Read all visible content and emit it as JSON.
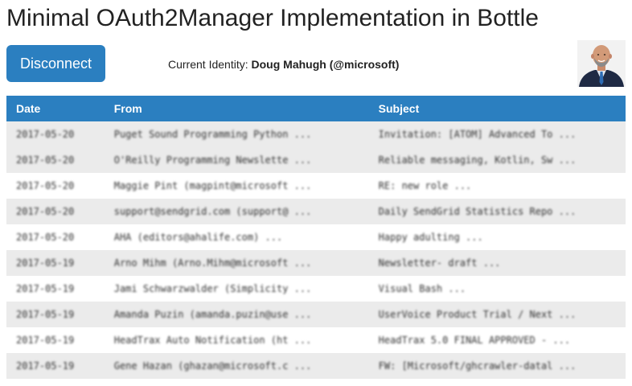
{
  "title": "Minimal OAuth2Manager Implementation in Bottle",
  "disconnect_label": "Disconnect",
  "identity": {
    "label": "Current Identity:",
    "name": "Doug Mahugh (@microsoft)"
  },
  "avatar": {
    "icon": "user-photo"
  },
  "colors": {
    "accent": "#2b7fc0",
    "row_band": "#ebebeb"
  },
  "table": {
    "headers": [
      "Date",
      "From",
      "Subject"
    ],
    "rows": [
      {
        "date": "2017-05-20",
        "from": "Puget Sound Programming Python ...",
        "subject": "Invitation: [ATOM] Advanced To ..."
      },
      {
        "date": "2017-05-20",
        "from": "O'Reilly Programming Newslette ...",
        "subject": "Reliable messaging, Kotlin, Sw ..."
      },
      {
        "date": "2017-05-20",
        "from": "Maggie Pint (magpint@microsoft ...",
        "subject": "RE: new role ..."
      },
      {
        "date": "2017-05-20",
        "from": "support@sendgrid.com (support@ ...",
        "subject": "Daily SendGrid Statistics Repo ..."
      },
      {
        "date": "2017-05-20",
        "from": "AHA (editors@ahalife.com) ...",
        "subject": "Happy adulting ..."
      },
      {
        "date": "2017-05-19",
        "from": "Arno Mihm (Arno.Mihm@microsoft ...",
        "subject": "Newsletter- draft ..."
      },
      {
        "date": "2017-05-19",
        "from": "Jami Schwarzwalder (Simplicity ...",
        "subject": "Visual Bash ..."
      },
      {
        "date": "2017-05-19",
        "from": "Amanda Puzin (amanda.puzin@use ...",
        "subject": "UserVoice Product Trial / Next ..."
      },
      {
        "date": "2017-05-19",
        "from": "HeadTrax Auto Notification (ht ...",
        "subject": "HeadTrax 5.0 FINAL APPROVED - ..."
      },
      {
        "date": "2017-05-19",
        "from": "Gene Hazan (ghazan@microsoft.c ...",
        "subject": "FW: [Microsoft/ghcrawler-datal ..."
      }
    ]
  }
}
